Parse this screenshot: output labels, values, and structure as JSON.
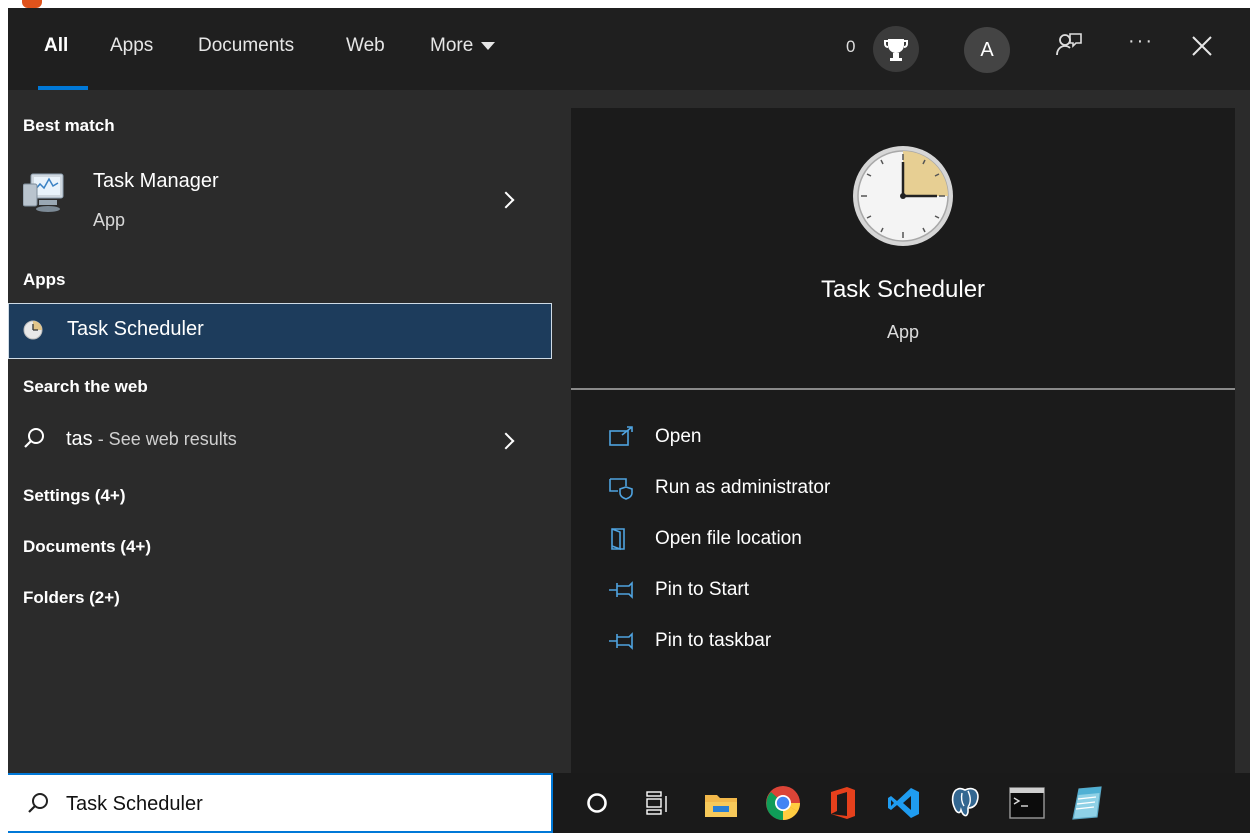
{
  "tabs": [
    {
      "label": "All",
      "active": true
    },
    {
      "label": "Apps"
    },
    {
      "label": "Documents"
    },
    {
      "label": "Web"
    },
    {
      "label": "More"
    }
  ],
  "header": {
    "points": "0",
    "avatar_letter": "A",
    "icons": [
      "trophy-icon",
      "feedback-icon",
      "ellipsis-icon",
      "close-icon"
    ]
  },
  "results": {
    "best_match_heading": "Best match",
    "best_match": {
      "title": "Task Manager",
      "subtitle": "App",
      "icon": "task-manager-icon"
    },
    "apps_heading": "Apps",
    "apps": [
      {
        "title": "Task Scheduler",
        "icon": "task-scheduler-icon"
      }
    ],
    "web_heading": "Search the web",
    "web": {
      "query": "tas",
      "suffix": " - See web results"
    },
    "categories": [
      "Settings (4+)",
      "Documents (4+)",
      "Folders (2+)"
    ]
  },
  "preview": {
    "title": "Task Scheduler",
    "subtitle": "App",
    "actions": [
      {
        "label": "Open",
        "icon": "open-icon"
      },
      {
        "label": "Run as administrator",
        "icon": "run-as-admin-icon"
      },
      {
        "label": "Open file location",
        "icon": "file-location-icon"
      },
      {
        "label": "Pin to Start",
        "icon": "pin-icon"
      },
      {
        "label": "Pin to taskbar",
        "icon": "pin-icon"
      }
    ]
  },
  "search": {
    "value": "Task Scheduler"
  },
  "taskbar": {
    "icons": [
      "cortana-icon",
      "task-view-icon",
      "file-explorer-icon",
      "chrome-icon",
      "office-icon",
      "vscode-icon",
      "postgresql-icon",
      "terminal-icon",
      "notepad-icon"
    ]
  },
  "colors": {
    "accent": "#0078d7",
    "selected_bg": "#1d3c5c",
    "panel_bg": "#2b2b2b",
    "topbar_bg": "#1f1f1f"
  }
}
